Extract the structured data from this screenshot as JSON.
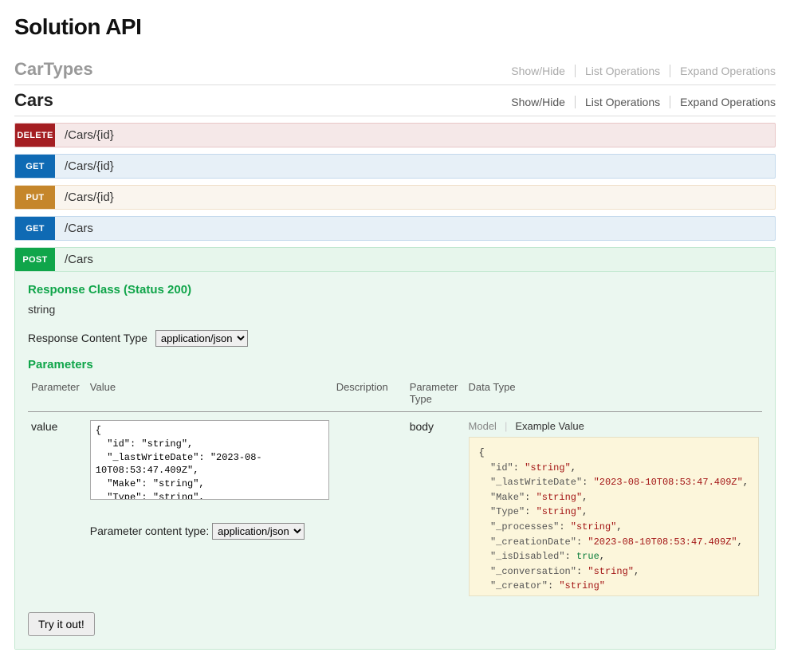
{
  "title": "Solution API",
  "sections": [
    {
      "name": "CarTypes",
      "active": false,
      "actions": [
        "Show/Hide",
        "List Operations",
        "Expand Operations"
      ]
    },
    {
      "name": "Cars",
      "active": true,
      "actions": [
        "Show/Hide",
        "List Operations",
        "Expand Operations"
      ],
      "operations": [
        {
          "method": "DELETE",
          "path": "/Cars/{id}",
          "cls": "op-delete"
        },
        {
          "method": "GET",
          "path": "/Cars/{id}",
          "cls": "op-get"
        },
        {
          "method": "PUT",
          "path": "/Cars/{id}",
          "cls": "op-put"
        },
        {
          "method": "GET",
          "path": "/Cars",
          "cls": "op-get"
        },
        {
          "method": "POST",
          "path": "/Cars",
          "cls": "op-post",
          "expanded": true
        }
      ]
    }
  ],
  "expanded": {
    "responseClassLabel": "Response Class (Status 200)",
    "responseType": "string",
    "responseContentTypeLabel": "Response Content Type",
    "responseContentTypeOptions": [
      "application/json"
    ],
    "parametersLabel": "Parameters",
    "columns": {
      "param": "Parameter",
      "value": "Value",
      "desc": "Description",
      "ptype": "Parameter Type",
      "dtype": "Data Type"
    },
    "row": {
      "paramName": "value",
      "paramType": "body",
      "bodyValue": "{\n  \"id\": \"string\",\n  \"_lastWriteDate\": \"2023-08-10T08:53:47.409Z\",\n  \"Make\": \"string\",\n  \"Type\": \"string\",\n  \"_processes\": \"string\",",
      "paramContentTypeLabel": "Parameter content type:",
      "paramContentTypeOptions": [
        "application/json"
      ]
    },
    "modelTabs": {
      "model": "Model",
      "example": "Example Value"
    },
    "exampleJson": {
      "id": "string",
      "_lastWriteDate": "2023-08-10T08:53:47.409Z",
      "Make": "string",
      "Type": "string",
      "_processes": "string",
      "_creationDate": "2023-08-10T08:53:47.409Z",
      "_isDisabled": true,
      "_conversation": "string",
      "_creator": "string"
    },
    "tryLabel": "Try it out!"
  }
}
